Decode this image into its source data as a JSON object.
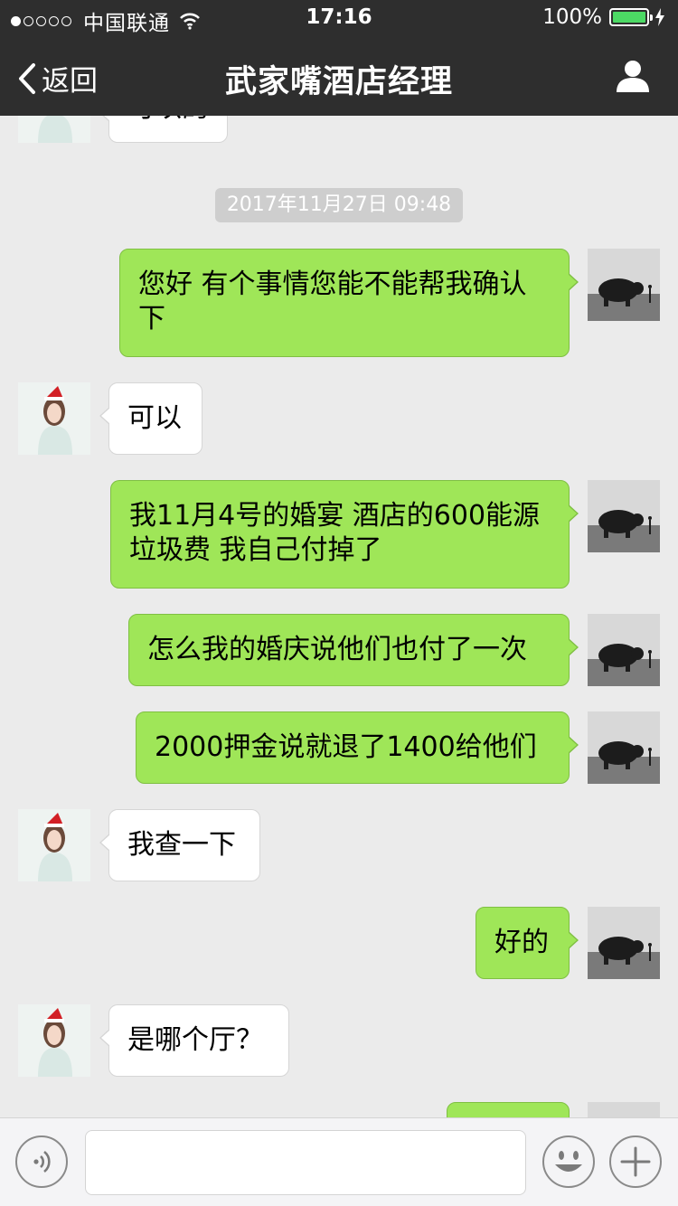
{
  "status_bar": {
    "carrier": "中国联通",
    "time": "17:16",
    "battery": "100%"
  },
  "nav": {
    "back_label": "返回",
    "title": "武家嘴酒店经理"
  },
  "chat": {
    "partial_top_text": "可以的",
    "timestamp": "2017年11月27日 09:48",
    "messages": [
      {
        "sender": "me",
        "lines": [
          "您好 有个事情您能不能帮我确认",
          "下"
        ]
      },
      {
        "sender": "other",
        "lines": [
          "可以"
        ]
      },
      {
        "sender": "me",
        "lines": [
          "我11月4号的婚宴 酒店的600能源",
          "垃圾费 我自己付掉了"
        ]
      },
      {
        "sender": "me",
        "lines": [
          "怎么我的婚庆说他们也付了一次"
        ]
      },
      {
        "sender": "me",
        "lines": [
          "2000押金说就退了1400给他们"
        ]
      },
      {
        "sender": "other",
        "lines": [
          "我查一下"
        ]
      },
      {
        "sender": "me",
        "lines": [
          "好的"
        ]
      },
      {
        "sender": "other",
        "lines": [
          "是哪个厅？"
        ]
      }
    ]
  },
  "colors": {
    "nav_bg": "#2e2e2e",
    "chat_bg": "#ebebeb",
    "my_bubble": "#9fe658",
    "other_bubble": "#ffffff",
    "battery_green": "#4cd964"
  },
  "icons": {
    "signal": "signal-dots-icon",
    "wifi": "wifi-icon",
    "battery": "battery-icon",
    "charging": "bolt-icon",
    "back": "back-chevron-icon",
    "profile": "person-icon",
    "voice": "voice-icon",
    "emoji": "emoji-icon",
    "plus": "plus-icon"
  }
}
